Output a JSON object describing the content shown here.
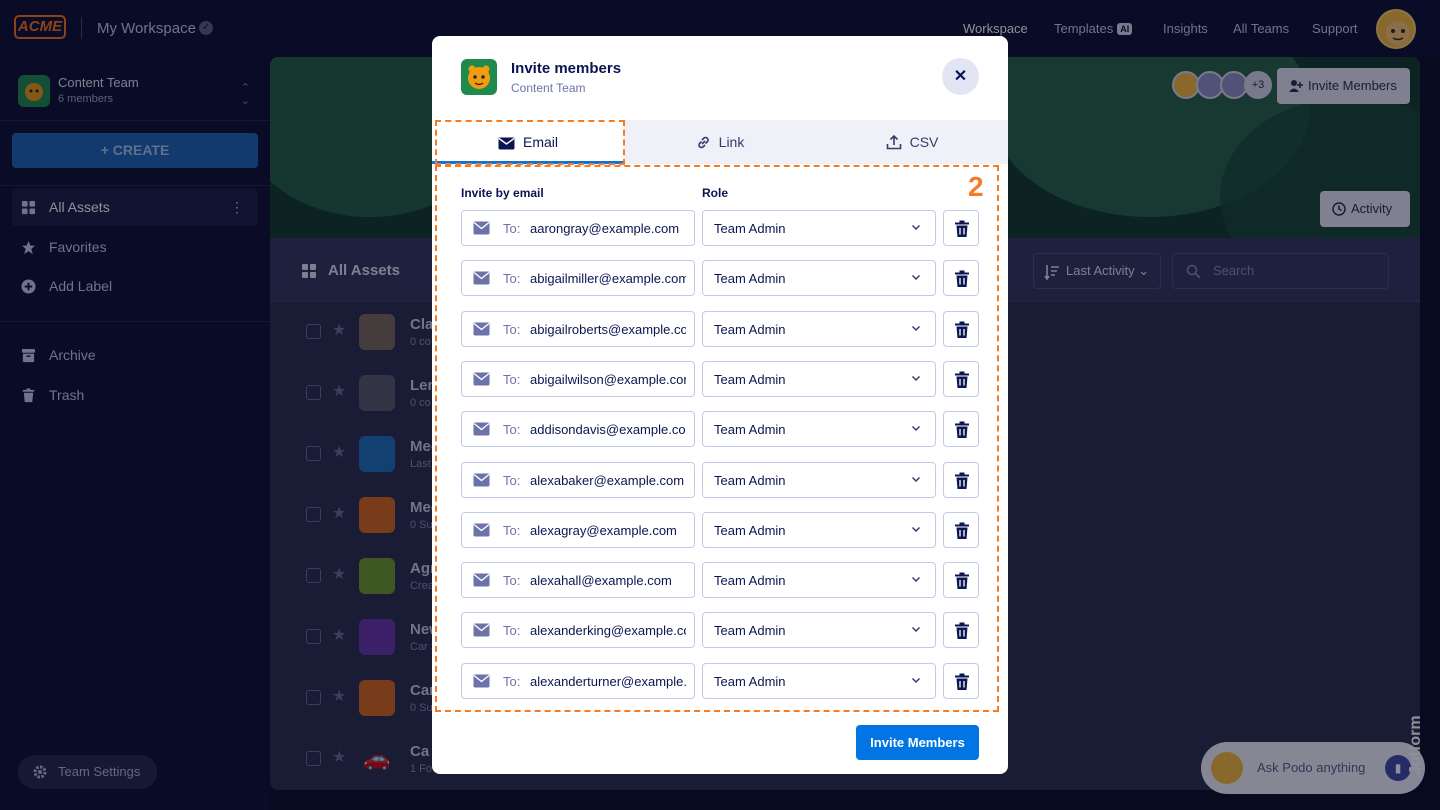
{
  "topbar": {
    "logo": "ACME",
    "workspace_title": "My Workspace",
    "nav": [
      "Workspace",
      "Templates",
      "Insights",
      "All Teams",
      "Support"
    ],
    "templates_badge": "AI"
  },
  "sidebar": {
    "team_name": "Content Team",
    "team_members": "6 members",
    "create_label": "+ CREATE",
    "items": [
      {
        "label": "All Assets",
        "icon": "grid-icon"
      },
      {
        "label": "Favorites",
        "icon": "star-icon"
      },
      {
        "label": "Add Label",
        "icon": "plus-circle-icon"
      },
      {
        "label": "Archive",
        "icon": "archive-icon"
      },
      {
        "label": "Trash",
        "icon": "trash-icon"
      }
    ],
    "team_settings": "Team Settings"
  },
  "main": {
    "invite_members_btn": "Invite Members",
    "avatar_count": "+3",
    "activity_btn": "Activity",
    "heading": "All Assets",
    "sort_label": "Last Activity",
    "search_placeholder": "Search",
    "rows": [
      {
        "title": "Cla",
        "sub": "0 co"
      },
      {
        "title": "Len",
        "sub": "0 co"
      },
      {
        "title": "Mee",
        "sub": "Last"
      },
      {
        "title": "Mee",
        "sub": "0 Su"
      },
      {
        "title": "Agr",
        "sub": "Crea"
      },
      {
        "title": "New",
        "sub": "Car S"
      },
      {
        "title": "Car",
        "sub": "0 Su"
      },
      {
        "title": "Ca",
        "sub": "1 Fo"
      }
    ]
  },
  "modal": {
    "title": "Invite members",
    "subtitle": "Content Team",
    "tabs": [
      "Email",
      "Link",
      "CSV"
    ],
    "col_email": "Invite by email",
    "col_role": "Role",
    "to_label": "To:",
    "invites": [
      {
        "email": "aarongray@example.com",
        "role": "Team Admin"
      },
      {
        "email": "abigailmiller@example.com",
        "role": "Team Admin"
      },
      {
        "email": "abigailroberts@example.co",
        "role": "Team Admin"
      },
      {
        "email": "abigailwilson@example.cor",
        "role": "Team Admin"
      },
      {
        "email": "addisondavis@example.cor",
        "role": "Team Admin"
      },
      {
        "email": "alexabaker@example.com",
        "role": "Team Admin"
      },
      {
        "email": "alexagray@example.com",
        "role": "Team Admin"
      },
      {
        "email": "alexahall@example.com",
        "role": "Team Admin"
      },
      {
        "email": "alexanderking@example.co",
        "role": "Team Admin"
      },
      {
        "email": "alexanderturner@example.c",
        "role": "Team Admin"
      }
    ],
    "invite_button": "Invite Members",
    "annotation_number": "2"
  },
  "podo": {
    "label": "Ask Podo anything"
  },
  "jotform": {
    "brand": "Jotform"
  },
  "colors": {
    "accent": "#0075e3",
    "annotation": "#f57c25",
    "brand_orange": "#f97316"
  }
}
